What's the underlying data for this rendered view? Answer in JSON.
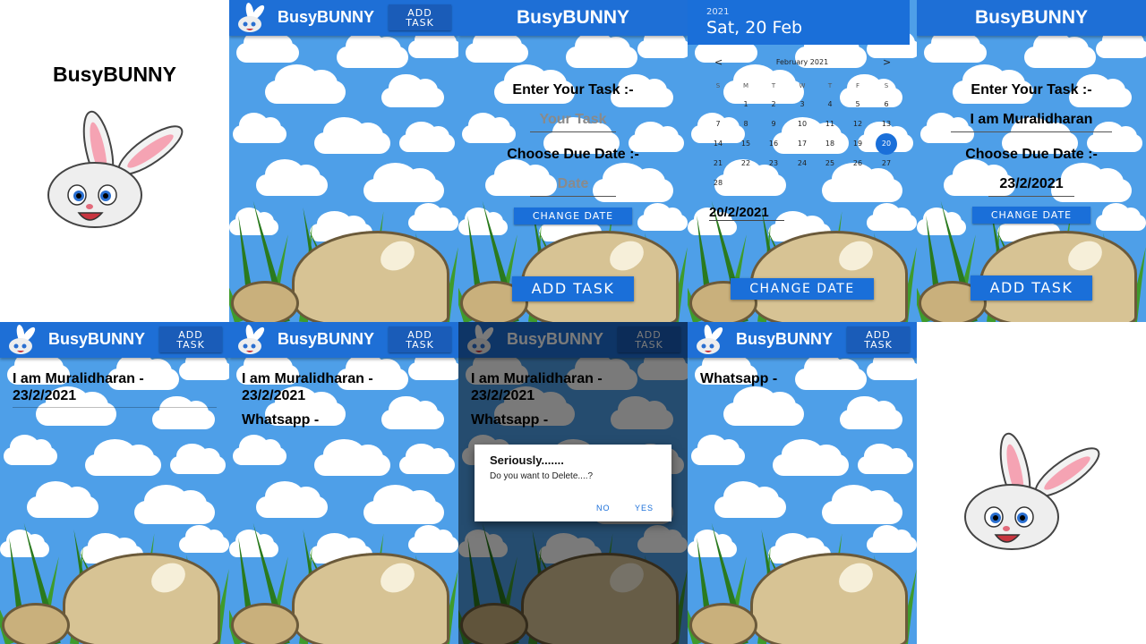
{
  "app": {
    "name": "BusyBUNNY",
    "add_task_line1": "ADD",
    "add_task_line2": "TASK"
  },
  "splash": {
    "title": "BusyBUNNY"
  },
  "form": {
    "task_label": "Enter Your Task :-",
    "task_placeholder": "Your Task",
    "due_label": "Choose Due Date :-",
    "date_placeholder": "Date",
    "change_date": "CHANGE DATE",
    "add_task": "ADD TASK"
  },
  "calendar": {
    "year": "2021",
    "date_heading": "Sat, 20 Feb",
    "month": "February 2021",
    "prev": "<",
    "next": ">",
    "weekdays": [
      "S",
      "M",
      "T",
      "W",
      "T",
      "F",
      "S"
    ],
    "weeks": [
      [
        "",
        "1",
        "2",
        "3",
        "4",
        "5",
        "6"
      ],
      [
        "7",
        "8",
        "9",
        "10",
        "11",
        "12",
        "13"
      ],
      [
        "14",
        "15",
        "16",
        "17",
        "18",
        "19",
        "20"
      ],
      [
        "21",
        "22",
        "23",
        "24",
        "25",
        "26",
        "27"
      ],
      [
        "28",
        "",
        "",
        "",
        "",
        "",
        ""
      ]
    ],
    "selected": "20",
    "picked_date": "20/2/2021",
    "change_date": "CHANGE DATE"
  },
  "filled_form": {
    "task_value": "I am Muralidharan",
    "date_value": "23/2/2021"
  },
  "tasks": {
    "task1_line1": "I am Muralidharan  -",
    "task1_line2": "23/2/2021",
    "task2": "Whatsapp  -"
  },
  "dialog": {
    "title": "Seriously.......",
    "message": "Do you want to Delete....?",
    "no": "NO",
    "yes": "YES"
  },
  "colors": {
    "sky": "#4e9fe8",
    "appbar": "#1e6fd6",
    "button": "#1a6fd9"
  }
}
